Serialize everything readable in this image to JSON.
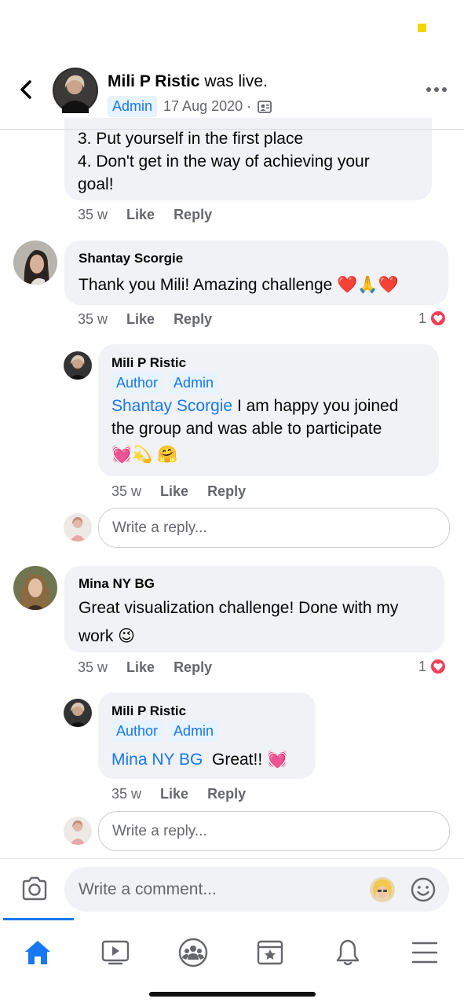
{
  "header": {
    "author": "Mili P Ristic",
    "action": "was live.",
    "badge": "Admin",
    "date": "17 Aug 2020 ·"
  },
  "comments": {
    "first": {
      "line1": "3. Put yourself in the first place",
      "line2": "4. Don't get in the way of achieving your",
      "line3": "goal!",
      "time": "35 w",
      "like": "Like",
      "reply": "Reply"
    },
    "shantay": {
      "name": "Shantay Scorgie",
      "text": "Thank you Mili! Amazing challenge ❤️🙏❤️",
      "time": "35 w",
      "like": "Like",
      "reply": "Reply",
      "reaction_count": "1"
    },
    "mili_reply_1": {
      "name": "Mili P Ristic",
      "badge_author": "Author",
      "badge_admin": "Admin",
      "mention": "Shantay Scorgie",
      "text_rest": " I am happy you joined",
      "line2": "the group and was able to participate",
      "emoji_line": "💓💫 🤗",
      "time": "35 w",
      "like": "Like",
      "reply": "Reply"
    },
    "mina": {
      "name": "Mina NY BG",
      "line1": "Great visualization challenge! Done with my",
      "line2": "work 😉",
      "time": "35 w",
      "like": "Like",
      "reply": "Reply",
      "reaction_count": "1"
    },
    "mili_reply_2": {
      "name": "Mili P Ristic",
      "badge_author": "Author",
      "badge_admin": "Admin",
      "mention": "Mina NY BG",
      "text_rest": "  Great!! 💓",
      "time": "35 w",
      "like": "Like",
      "reply": "Reply"
    }
  },
  "reply_placeholder": "Write a reply...",
  "composer": {
    "placeholder": "Write a comment..."
  },
  "tabs": [
    "home-icon",
    "video-icon",
    "groups-icon",
    "pages-icon",
    "notifications-icon",
    "menu-icon"
  ],
  "colors": {
    "accent": "#1877f2",
    "bubble": "#f0f2f5",
    "heart": "#f33e58"
  }
}
